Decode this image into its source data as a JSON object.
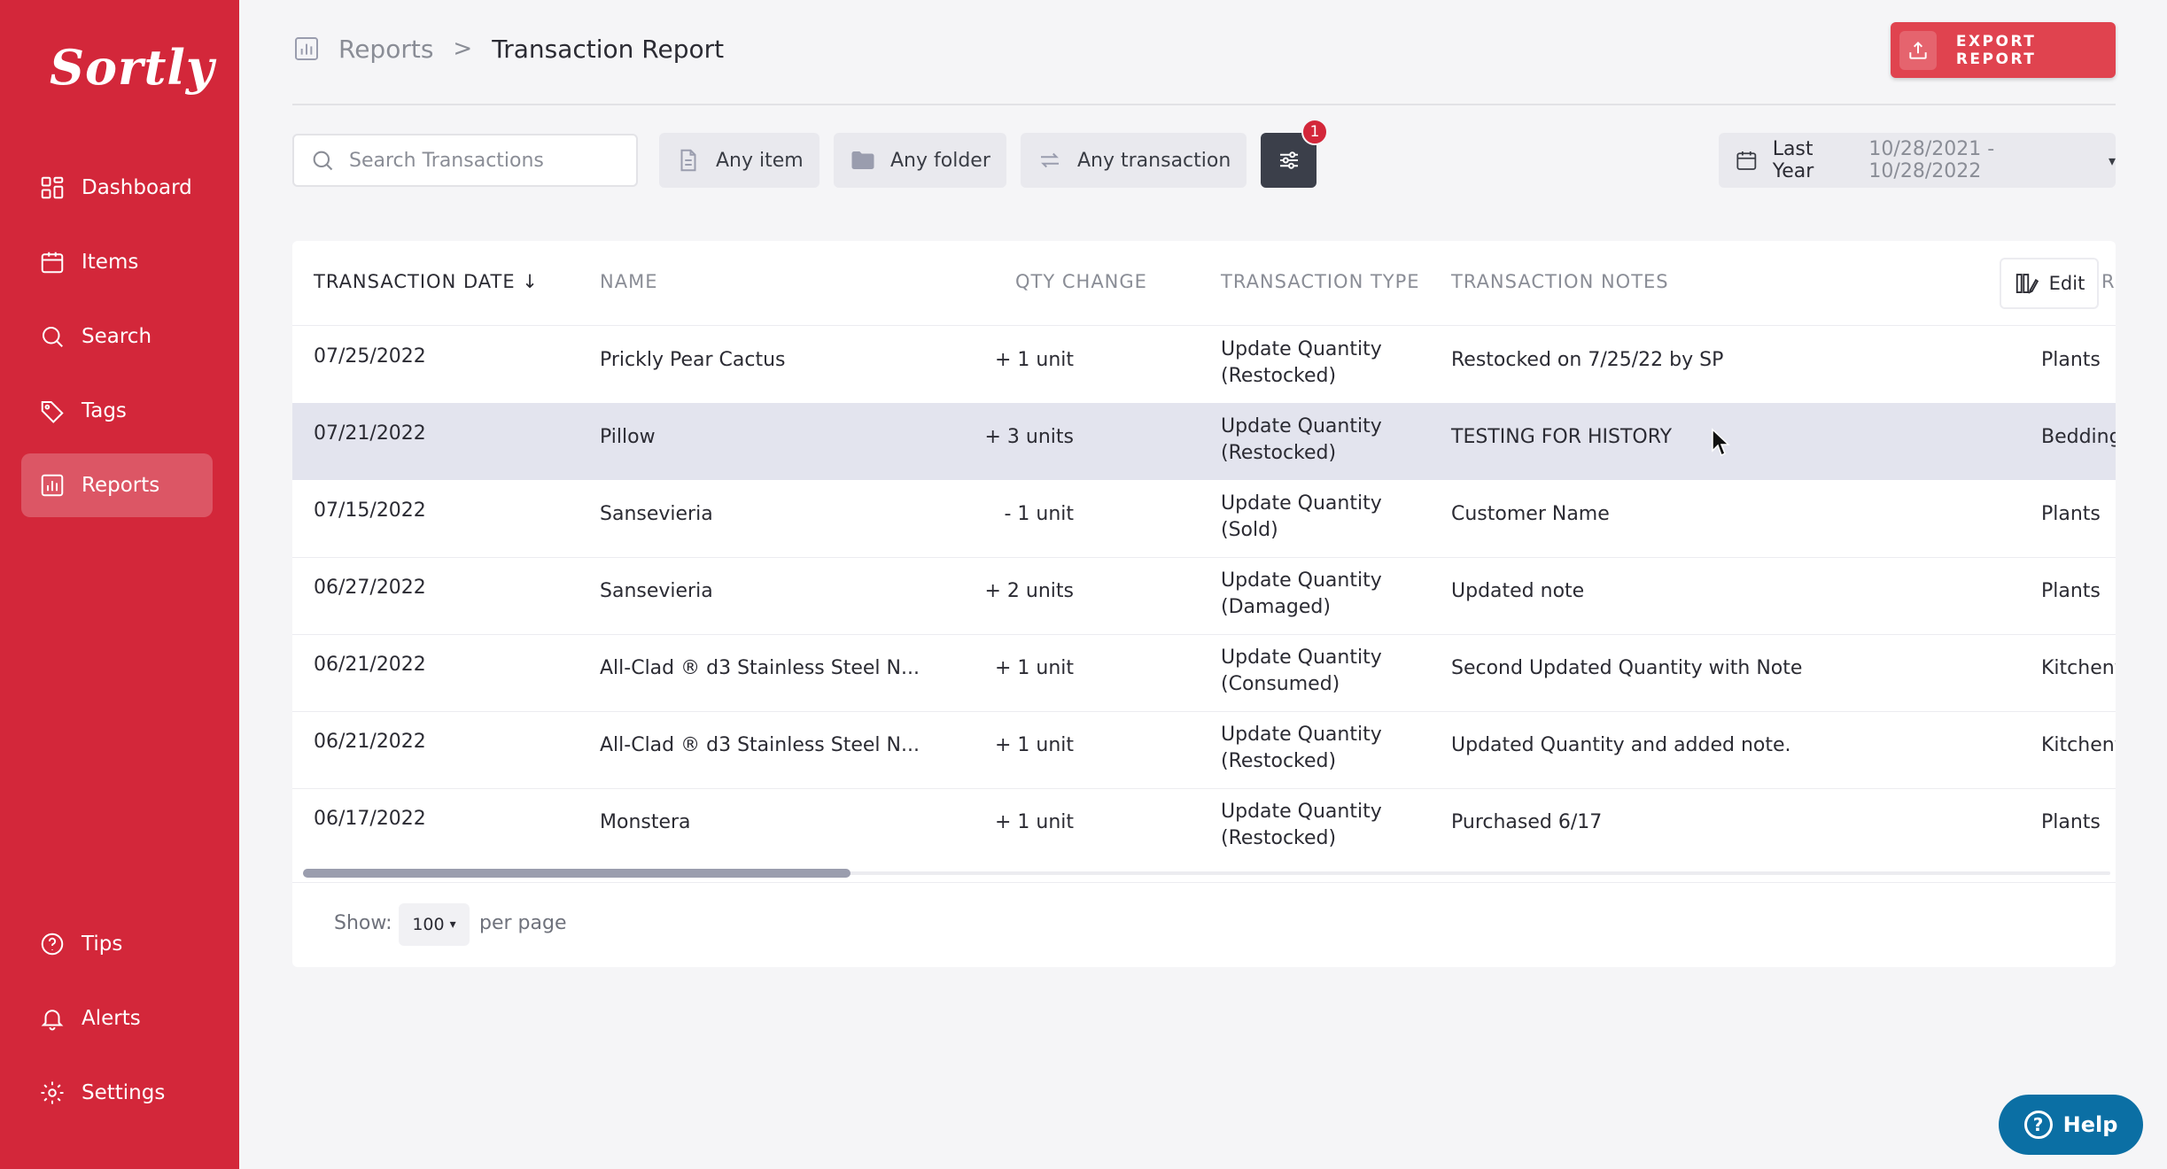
{
  "sidebar": {
    "logo": "Sortly",
    "items": [
      {
        "label": "Dashboard",
        "icon": "dashboard-icon"
      },
      {
        "label": "Items",
        "icon": "items-icon"
      },
      {
        "label": "Search",
        "icon": "search-icon"
      },
      {
        "label": "Tags",
        "icon": "tag-icon"
      },
      {
        "label": "Reports",
        "icon": "reports-icon",
        "active": true
      }
    ],
    "bottom_items": [
      {
        "label": "Tips",
        "icon": "question-icon"
      },
      {
        "label": "Alerts",
        "icon": "bell-icon"
      },
      {
        "label": "Settings",
        "icon": "gear-icon"
      }
    ]
  },
  "header": {
    "breadcrumb_parent": "Reports",
    "breadcrumb_sep": ">",
    "breadcrumb_current": "Transaction Report",
    "export_label": "EXPORT REPORT"
  },
  "filters": {
    "search_placeholder": "Search Transactions",
    "item_filter": "Any item",
    "folder_filter": "Any folder",
    "transaction_filter": "Any transaction",
    "active_filter_count": "1",
    "date_label": "Last Year",
    "date_range": "10/28/2021 - 10/28/2022"
  },
  "table": {
    "columns": {
      "date": "TRANSACTION DATE",
      "name": "NAME",
      "qty": "QTY CHANGE",
      "type": "TRANSACTION TYPE",
      "notes": "TRANSACTION NOTES",
      "cut": "R"
    },
    "edit_label": "Edit",
    "rows": [
      {
        "date": "07/25/2022",
        "name": "Prickly Pear Cactus",
        "qty": "+ 1  unit",
        "type1": "Update Quantity",
        "type2": "(Restocked)",
        "notes": "Restocked on 7/25/22 by SP",
        "folder": "Plants"
      },
      {
        "date": "07/21/2022",
        "name": "Pillow",
        "qty": "+ 3  units",
        "type1": "Update Quantity",
        "type2": "(Restocked)",
        "notes": "TESTING FOR HISTORY",
        "folder": "Bedding"
      },
      {
        "date": "07/15/2022",
        "name": "Sansevieria",
        "qty": "- 1  unit",
        "type1": "Update Quantity",
        "type2": "(Sold)",
        "notes": "Customer Name",
        "folder": "Plants"
      },
      {
        "date": "06/27/2022",
        "name": "Sansevieria",
        "qty": "+ 2  units",
        "type1": "Update Quantity",
        "type2": "(Damaged)",
        "notes": "Updated note",
        "folder": "Plants"
      },
      {
        "date": "06/21/2022",
        "name": "All-Clad ® d3 Stainless Steel N...",
        "qty": "+ 1  unit",
        "type1": "Update Quantity",
        "type2": "(Consumed)",
        "notes": "Second Updated Quantity with Note",
        "folder": "Kitchenw"
      },
      {
        "date": "06/21/2022",
        "name": "All-Clad ® d3 Stainless Steel N...",
        "qty": "+ 1  unit",
        "type1": "Update Quantity",
        "type2": "(Restocked)",
        "notes": "Updated Quantity and added note.",
        "folder": "Kitchenw"
      },
      {
        "date": "06/17/2022",
        "name": "Monstera",
        "qty": "+ 1  unit",
        "type1": "Update Quantity",
        "type2": "(Restocked)",
        "notes": "Purchased 6/17",
        "folder": "Plants"
      }
    ]
  },
  "pagination": {
    "show_label": "Show:",
    "per_page_value": "100",
    "per_page_label": "per page"
  },
  "help": {
    "label": "Help"
  },
  "colors": {
    "sidebar": "#d3273a",
    "export": "#e0434f",
    "filter_button": "#3b3f4a",
    "help": "#0b6fa4",
    "highlight_row": "#e3e4ee"
  }
}
